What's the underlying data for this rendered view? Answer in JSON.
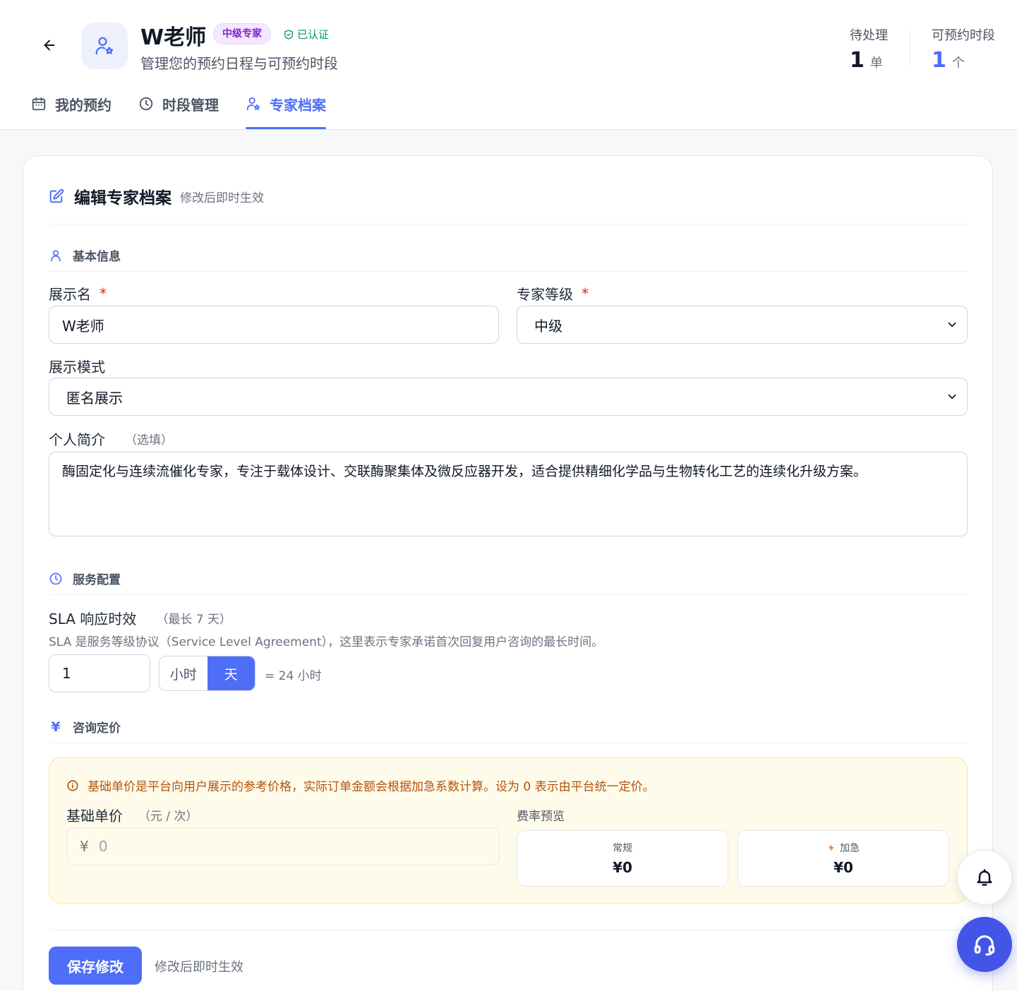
{
  "header": {
    "name": "W老师",
    "level_badge": "中级专家",
    "verified": "已认证",
    "subtitle": "管理您的预约日程与可预约时段",
    "stats": [
      {
        "label": "待处理",
        "value": "1",
        "unit": "单",
        "color": "#111827"
      },
      {
        "label": "可预约时段",
        "value": "1",
        "unit": "个",
        "color": "#4f6ef7"
      }
    ]
  },
  "tabs": [
    {
      "label": "我的预约",
      "icon": "calendar-icon",
      "active": false
    },
    {
      "label": "时段管理",
      "icon": "clock-icon",
      "active": false
    },
    {
      "label": "专家档案",
      "icon": "user-star-icon",
      "active": true
    }
  ],
  "card": {
    "title": "编辑专家档案",
    "hint": "修改后即时生效"
  },
  "basic": {
    "section_title": "基本信息",
    "display_name_label": "展示名",
    "display_name_value": "W老师",
    "level_label": "专家等级",
    "level_value": "中级",
    "mode_label": "展示模式",
    "mode_value": "匿名展示",
    "bio_label": "个人简介",
    "bio_optional": "（选填）",
    "bio_value": "酶固定化与连续流催化专家，专注于载体设计、交联酶聚集体及微反应器开发，适合提供精细化学品与生物转化工艺的连续化升级方案。"
  },
  "service": {
    "section_title": "服务配置",
    "sla_label": "SLA 响应时效",
    "sla_max": "（最长 7 天）",
    "sla_desc": "SLA 是服务等级协议（Service Level Agreement），这里表示专家承诺首次回复用户咨询的最长时间。",
    "sla_value": "1",
    "unit_hour": "小时",
    "unit_day": "天",
    "selected_unit": "天",
    "sla_equals": "= 24 小时"
  },
  "pricing": {
    "section_title": "咨询定价",
    "note": "基础单价是平台向用户展示的参考价格，实际订单金额会根据加急系数计算。设为 0 表示由平台统一定价。",
    "price_label": "基础单价",
    "price_unit": "（元 / 次）",
    "currency": "¥",
    "price_placeholder": "0",
    "rate_preview_label": "费率预览",
    "rates": [
      {
        "name": "常规",
        "value": "¥0"
      },
      {
        "name": "加急",
        "value": "¥0"
      }
    ]
  },
  "footer": {
    "save_label": "保存修改",
    "hint": "修改后即时生效"
  },
  "colors": {
    "accent": "#4f6ef7",
    "required": "#dc2626",
    "verified": "#059669",
    "warning_text": "#b45309",
    "warning_bg": "#fffbeb"
  }
}
